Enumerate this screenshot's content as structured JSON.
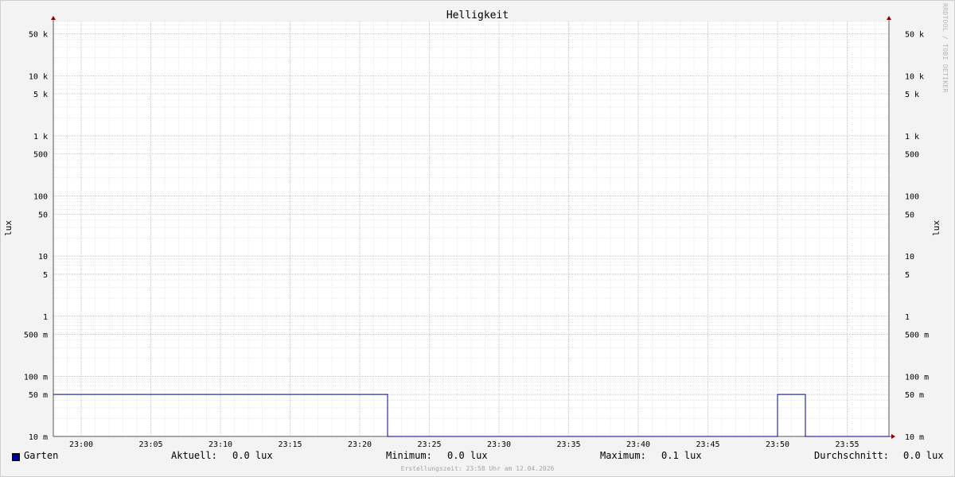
{
  "chart_data": {
    "type": "line",
    "title": "Helligkeit",
    "ylabel_left": "lux",
    "ylabel_right": "lux",
    "yscale": "log",
    "ylim": [
      0.01,
      80000
    ],
    "x_ticks": [
      "23:00",
      "23:05",
      "23:10",
      "23:15",
      "23:20",
      "23:25",
      "23:30",
      "23:35",
      "23:40",
      "23:45",
      "23:50",
      "23:55"
    ],
    "xlim": [
      "22:58",
      "23:58"
    ],
    "y_ticks": [
      {
        "value": 50000,
        "label": "50 k"
      },
      {
        "value": 10000,
        "label": "10 k"
      },
      {
        "value": 5000,
        "label": "5 k"
      },
      {
        "value": 1000,
        "label": "1 k"
      },
      {
        "value": 500,
        "label": "500"
      },
      {
        "value": 100,
        "label": "100"
      },
      {
        "value": 50,
        "label": "50"
      },
      {
        "value": 10,
        "label": "10"
      },
      {
        "value": 5,
        "label": "5"
      },
      {
        "value": 1,
        "label": "1"
      },
      {
        "value": 0.5,
        "label": "500 m"
      },
      {
        "value": 0.1,
        "label": "100 m"
      },
      {
        "value": 0.05,
        "label": "50 m"
      },
      {
        "value": 0.01,
        "label": "10 m"
      }
    ],
    "grid": true,
    "series": [
      {
        "name": "Garten",
        "color": "#00008b",
        "points": [
          {
            "x": "22:58",
            "y": 0.05
          },
          {
            "x": "23:22",
            "y": 0.05
          },
          {
            "x": "23:22",
            "y": 0.0
          },
          {
            "x": "23:50",
            "y": 0.0
          },
          {
            "x": "23:50",
            "y": 0.05
          },
          {
            "x": "23:52",
            "y": 0.05
          },
          {
            "x": "23:52",
            "y": 0.0
          },
          {
            "x": "23:58",
            "y": 0.0
          }
        ]
      }
    ]
  },
  "legend": {
    "series_name": "Garten",
    "aktuell_label": "Aktuell:",
    "aktuell_value": "0.0 lux",
    "minimum_label": "Minimum:",
    "minimum_value": "0.0 lux",
    "maximum_label": "Maximum:",
    "maximum_value": "0.1 lux",
    "durchschnitt_label": "Durchschnitt:",
    "durchschnitt_value": "0.0 lux"
  },
  "footer": "Erstellungszeit: 23:58 Uhr am 12.04.2026",
  "watermark": "RRDTOOL / TOBI OETIKER"
}
